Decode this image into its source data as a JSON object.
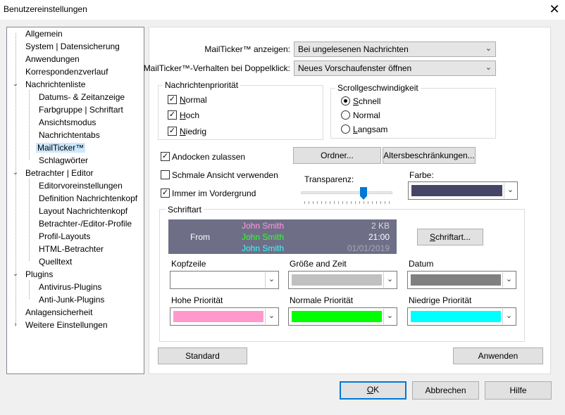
{
  "window": {
    "title": "Benutzereinstellungen",
    "close_glyph": "✕"
  },
  "tree": {
    "items": [
      {
        "label": "Allgemein"
      },
      {
        "label": "System | Datensicherung"
      },
      {
        "label": "Anwendungen"
      },
      {
        "label": "Korrespondenzverlauf"
      },
      {
        "label": "Nachrichtenliste"
      },
      {
        "label": "Datums- & Zeitanzeige"
      },
      {
        "label": "Farbgruppe | Schriftart"
      },
      {
        "label": "Ansichtsmodus"
      },
      {
        "label": "Nachrichtentabs"
      },
      {
        "label": "MailTicker™"
      },
      {
        "label": "Schlagwörter"
      },
      {
        "label": "Betrachter | Editor"
      },
      {
        "label": "Editorvoreinstellungen"
      },
      {
        "label": "Definition Nachrichtenkopf"
      },
      {
        "label": "Layout Nachrichtenkopf"
      },
      {
        "label": "Betrachter-/Editor-Profile"
      },
      {
        "label": "Profil-Layouts"
      },
      {
        "label": "HTML-Betrachter"
      },
      {
        "label": "Quelltext"
      },
      {
        "label": "Plugins"
      },
      {
        "label": "Antivirus-Plugins"
      },
      {
        "label": "Anti-Junk-Plugins"
      },
      {
        "label": "Anlagensicherheit"
      },
      {
        "label": "Weitere Einstellungen"
      }
    ]
  },
  "mailticker": {
    "show_label": "MailTicker™ anzeigen:",
    "show_value": "Bei ungelesenen Nachrichten",
    "dblclick_label": "MailTicker™-Verhalten bei Doppelklick:",
    "dblclick_value": "Neues Vorschaufenster öffnen"
  },
  "priority": {
    "title": "Nachrichtenpriorität",
    "normal": "Normal",
    "hoch": "Hoch",
    "niedrig": "Niedrig"
  },
  "scroll": {
    "title": "Scrollgeschwindigkeit",
    "schnell": "Schnell",
    "normal": "Normal",
    "langsam": "Langsam"
  },
  "options": {
    "andocken": "Andocken zulassen",
    "schmal": "Schmale Ansicht verwenden",
    "vordergrund": "Immer im Vordergrund",
    "ordner_btn": "Ordner...",
    "alters_btn": "Altersbeschränkungen...",
    "transparenz": "Transparenz:",
    "transparenz_value": 0.7,
    "farbe": "Farbe:",
    "farbe_color": "#454565"
  },
  "font": {
    "title": "Schriftart",
    "preview_from": "From",
    "preview_names": [
      "John Smith",
      "John Smith",
      "John Smith"
    ],
    "preview_values": [
      "2 KB",
      "21:00",
      "01/01/2019"
    ],
    "preview_name_colors": [
      "#ff99dd",
      "#33ff33",
      "#33ffff"
    ],
    "preview_bg": "#6f6e87",
    "btn": "Schriftart...",
    "kopfzeile": "Kopfzeile",
    "groesse": "Größe and Zeit",
    "datum": "Datum",
    "hohe": "Hohe Priorität",
    "normale": "Normale Priorität",
    "niedrige": "Niedrige Priorität",
    "swatch_kopfzeile": "#ffffff",
    "swatch_groesse": "#c0c0c0",
    "swatch_datum": "#808080",
    "swatch_hohe": "#ff99cc",
    "swatch_normale": "#00ff00",
    "swatch_niedrige": "#00ffff"
  },
  "panel_buttons": {
    "standard": "Standard",
    "anwenden": "Anwenden"
  },
  "footer": {
    "ok": "OK",
    "abbrechen": "Abbrechen",
    "hilfe": "Hilfe"
  }
}
